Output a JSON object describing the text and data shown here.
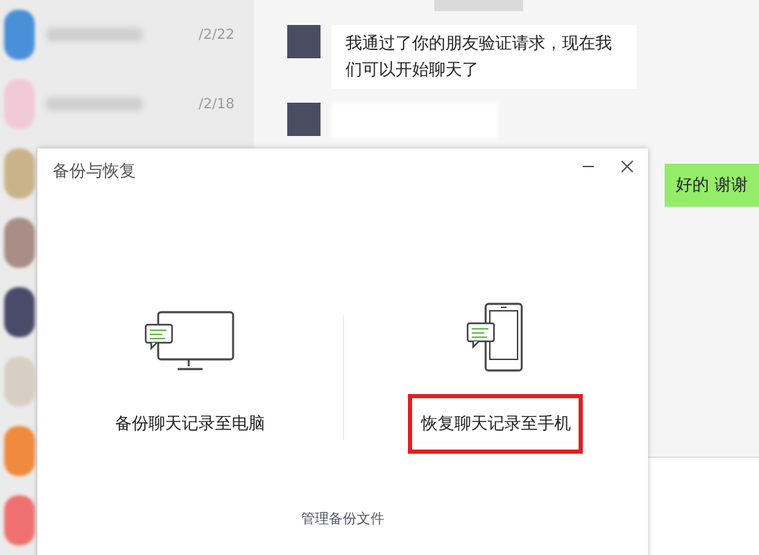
{
  "sidebar": {
    "items": [
      {
        "color": "#4a90d9",
        "date": "/2/22"
      },
      {
        "color": "#f2c9d6",
        "date": "/2/18"
      },
      {
        "color": "#c9b48a"
      },
      {
        "color": "#a88e86"
      },
      {
        "color": "#4a4a6a"
      },
      {
        "color": "#d8cfc4"
      },
      {
        "color": "#f08a3c"
      },
      {
        "color": "#f07070"
      }
    ]
  },
  "chat": {
    "messages": [
      {
        "kind": "received",
        "text": "我通过了你的朋友验证请求，现在我们可以开始聊天了"
      },
      {
        "kind": "blurred"
      },
      {
        "kind": "sent",
        "text": "好的 谢谢"
      }
    ]
  },
  "dialog": {
    "title": "备份与恢复",
    "options": [
      {
        "kind": "computer",
        "label": "备份聊天记录至电脑",
        "highlighted": false
      },
      {
        "kind": "phone",
        "label": "恢复聊天记录至手机",
        "highlighted": true
      }
    ],
    "link": "管理备份文件"
  }
}
